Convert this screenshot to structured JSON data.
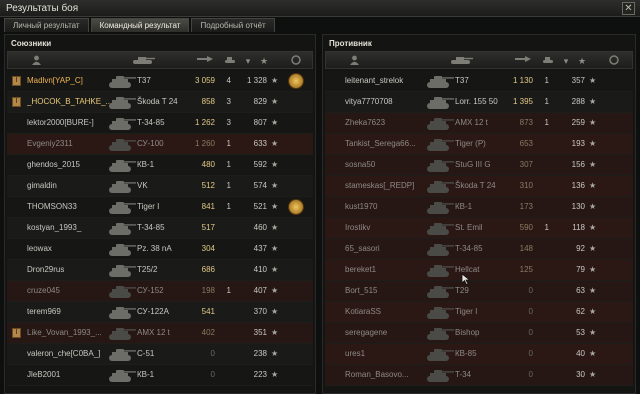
{
  "window": {
    "title": "Результаты боя",
    "close_icon": "close-icon"
  },
  "tabs": [
    {
      "label": "Личный результат",
      "active": false
    },
    {
      "label": "Командный результат",
      "active": true
    },
    {
      "label": "Подробный отчёт",
      "active": false
    }
  ],
  "left": {
    "title": "Союзники",
    "columns": [
      "player-icon",
      "tank-icon",
      "damage-icon",
      "kills-icon",
      "xp-sort-icon",
      "medal-icon"
    ],
    "rows": [
      {
        "name": "Madlvn[YAP_C]",
        "tank": "T37",
        "damage": "3 059",
        "kills": "4",
        "xp": "1 328",
        "self": true,
        "platoon": true,
        "medal": true,
        "dead": false
      },
      {
        "name": "_HOCOK_B_TAHKE_...",
        "tank": "Škoda T 24",
        "damage": "858",
        "kills": "3",
        "xp": "829",
        "platoon": true,
        "dead": false
      },
      {
        "name": "lektor2000[BURE-]",
        "tank": "T-34-85",
        "damage": "1 262",
        "kills": "3",
        "xp": "807",
        "dead": false
      },
      {
        "name": "Evgeniy2311",
        "tank": "СУ-100",
        "damage": "1 260",
        "kills": "1",
        "xp": "633",
        "dead": true
      },
      {
        "name": "ghendos_2015",
        "tank": "КВ-1",
        "damage": "480",
        "kills": "1",
        "xp": "592",
        "dead": false
      },
      {
        "name": "gimaldin",
        "tank": "VK",
        "damage": "512",
        "kills": "1",
        "xp": "574",
        "dead": false
      },
      {
        "name": "THOMSON33",
        "tank": "Tiger I",
        "damage": "841",
        "kills": "1",
        "xp": "521",
        "medal": true,
        "dead": false
      },
      {
        "name": "kostyan_1993_",
        "tank": "T-34-85",
        "damage": "517",
        "kills": "",
        "xp": "460",
        "dead": false
      },
      {
        "name": "leowax",
        "tank": "Pz. 38 nA",
        "damage": "304",
        "kills": "",
        "xp": "437",
        "dead": false
      },
      {
        "name": "Dron29rus",
        "tank": "T25/2",
        "damage": "686",
        "kills": "",
        "xp": "410",
        "dead": false
      },
      {
        "name": "cruze045",
        "tank": "СУ-152",
        "damage": "198",
        "kills": "1",
        "xp": "407",
        "dead": true
      },
      {
        "name": "terem969",
        "tank": "СУ-122А",
        "damage": "541",
        "kills": "",
        "xp": "370",
        "dead": false
      },
      {
        "name": "Like_Vovan_1993_...",
        "tank": "AMX 12 t",
        "damage": "402",
        "kills": "",
        "xp": "351",
        "platoon": true,
        "dead": true
      },
      {
        "name": "valeron_che[C0BA_]",
        "tank": "C-51",
        "damage": "0",
        "kills": "",
        "xp": "238",
        "dead": false
      },
      {
        "name": "JleB2001",
        "tank": "КВ-1",
        "damage": "0",
        "kills": "",
        "xp": "223",
        "dead": false
      }
    ]
  },
  "right": {
    "title": "Противник",
    "columns": [
      "player-icon",
      "tank-icon",
      "damage-icon",
      "kills-icon",
      "xp-sort-icon",
      "medal-icon"
    ],
    "rows": [
      {
        "name": "leitenant_strelok",
        "tank": "T37",
        "damage": "1 130",
        "kills": "1",
        "xp": "357",
        "dead": false
      },
      {
        "name": "vitya7770708",
        "tank": "Lorr. 155 50",
        "damage": "1 395",
        "kills": "1",
        "xp": "288",
        "dead": false
      },
      {
        "name": "Zheka7623",
        "tank": "AMX 12 t",
        "damage": "873",
        "kills": "1",
        "xp": "259",
        "dead": true
      },
      {
        "name": "Tankist_Serega66...",
        "tank": "Tiger (P)",
        "damage": "653",
        "kills": "",
        "xp": "193",
        "dead": true
      },
      {
        "name": "sosna50",
        "tank": "StuG III G",
        "damage": "307",
        "kills": "",
        "xp": "156",
        "dead": true
      },
      {
        "name": "stameskas[_REDP]",
        "tank": "Škoda T 24",
        "damage": "310",
        "kills": "",
        "xp": "136",
        "dead": true
      },
      {
        "name": "kust1970",
        "tank": "КВ-1",
        "damage": "173",
        "kills": "",
        "xp": "130",
        "dead": true
      },
      {
        "name": "Irostikv",
        "tank": "St. Emil",
        "damage": "590",
        "kills": "1",
        "xp": "118",
        "dead": true
      },
      {
        "name": "65_sasori",
        "tank": "T-34-85",
        "damage": "148",
        "kills": "",
        "xp": "92",
        "dead": true
      },
      {
        "name": "bereket1",
        "tank": "Hellcat",
        "damage": "125",
        "kills": "",
        "xp": "79",
        "dead": true
      },
      {
        "name": "Bort_515",
        "tank": "T29",
        "damage": "0",
        "kills": "",
        "xp": "63",
        "dead": true
      },
      {
        "name": "KotiaraSS",
        "tank": "Tiger I",
        "damage": "0",
        "kills": "",
        "xp": "62",
        "dead": true
      },
      {
        "name": "seregagene",
        "tank": "Bishop",
        "damage": "0",
        "kills": "",
        "xp": "53",
        "dead": true
      },
      {
        "name": "ures1",
        "tank": "КВ-85",
        "damage": "0",
        "kills": "",
        "xp": "40",
        "dead": true
      },
      {
        "name": "Roman_Basovo...",
        "tank": "T-34",
        "damage": "0",
        "kills": "",
        "xp": "30",
        "dead": true
      }
    ]
  },
  "colors": {
    "self": "#f0b254",
    "platoon": "#e8c87a",
    "damage": "#e2c886",
    "dead_row": "#261614"
  }
}
